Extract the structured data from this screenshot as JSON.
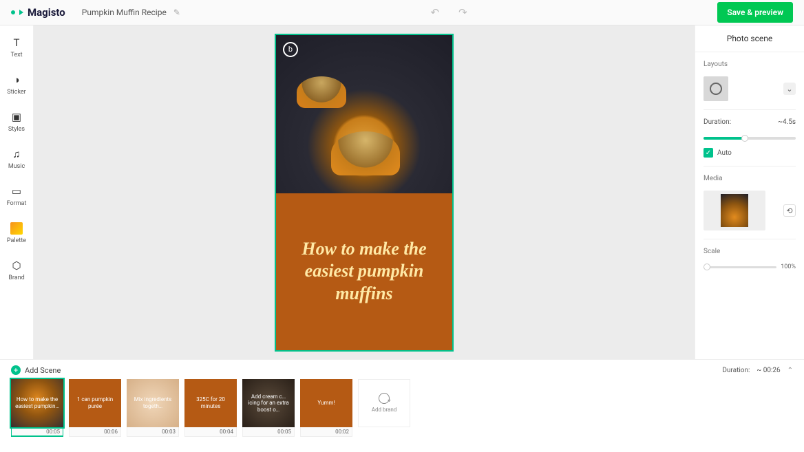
{
  "header": {
    "brand": "Magisto",
    "project_title": "Pumpkin Muffin Recipe",
    "save_label": "Save & preview"
  },
  "leftbar": {
    "items": [
      {
        "label": "Text",
        "icon": "T"
      },
      {
        "label": "Sticker",
        "icon": "◑"
      },
      {
        "label": "Styles",
        "icon": "▣"
      },
      {
        "label": "Music",
        "icon": "♫"
      },
      {
        "label": "Format",
        "icon": "▭"
      },
      {
        "label": "Palette",
        "icon": ""
      },
      {
        "label": "Brand",
        "icon": "⬡"
      }
    ]
  },
  "scene": {
    "headline": "How to make the easiest pumpkin muffins"
  },
  "rightpanel": {
    "title": "Photo scene",
    "layouts_label": "Layouts",
    "duration_label": "Duration:",
    "duration_value": "~4.5s",
    "duration_fill_pct": 45,
    "auto_label": "Auto",
    "auto_checked": true,
    "media_label": "Media",
    "scale_label": "Scale",
    "scale_value": "100%"
  },
  "timeline": {
    "add_scene_label": "Add Scene",
    "duration_total_label": "Duration:",
    "duration_total_value": "~ 00:26",
    "clips": [
      {
        "text": "How to make the easiest pumpkin…",
        "time": "00:05",
        "cls": "c0",
        "selected": true
      },
      {
        "text": "1 can pumpkin purée",
        "time": "00:06",
        "cls": "c1"
      },
      {
        "text": "Mix ingredients togeth…",
        "time": "00:03",
        "cls": "c2"
      },
      {
        "text": "325C for 20 minutes",
        "time": "00:04",
        "cls": "c3"
      },
      {
        "text": "Add cream c… icing for an extra boost o…",
        "time": "00:05",
        "cls": "c4"
      },
      {
        "text": "Yumm!",
        "time": "00:02",
        "cls": "c5"
      }
    ],
    "add_brand_label": "Add brand"
  }
}
